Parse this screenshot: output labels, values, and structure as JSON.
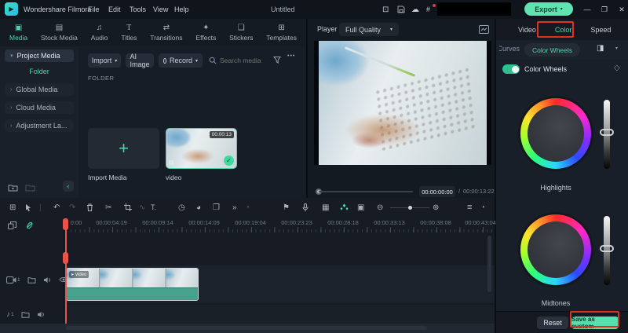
{
  "titlebar": {
    "app_name": "Wondershare Filmora",
    "menus": [
      "File",
      "Edit",
      "Tools",
      "View",
      "Help"
    ],
    "project_name": "Untitled",
    "export_label": "Export",
    "logo_glyph": "▶",
    "icons": {
      "display": "⊡",
      "cloud": "☁",
      "shortcut": "#",
      "chevron": "▾",
      "minimize": "—",
      "restore": "❐",
      "close": "✕"
    }
  },
  "media_panel": {
    "tabs": [
      {
        "label": "Media",
        "icon": "▣"
      },
      {
        "label": "Stock Media",
        "icon": "▤"
      },
      {
        "label": "Audio",
        "icon": "♫"
      },
      {
        "label": "Titles",
        "icon": "T"
      },
      {
        "label": "Transitions",
        "icon": "⇄"
      },
      {
        "label": "Effects",
        "icon": "✦"
      },
      {
        "label": "Stickers",
        "icon": "❏"
      },
      {
        "label": "Templates",
        "icon": "⊞"
      }
    ],
    "sidebar": {
      "project": "Project Media",
      "folder": "Folder",
      "items": [
        "Global Media",
        "Cloud Media",
        "Adjustment La..."
      ],
      "chevron_open": "▾",
      "chevron": "›",
      "collapse": "‹"
    },
    "toolbar": {
      "import_label": "Import",
      "ai_label": "AI Image",
      "record_label": "Record",
      "search_placeholder": "Search media",
      "more": "•••",
      "chevron": "▾"
    },
    "section_label": "FOLDER",
    "tiles": {
      "plus": "+",
      "import_label": "Import Media",
      "video_label": "video",
      "duration": "00:00:13",
      "check": "✓",
      "clip_type": "▤"
    }
  },
  "player": {
    "label": "Player",
    "quality": "Full Quality",
    "chevron": "▾",
    "current_time": "00:00:00:00",
    "separator": "/",
    "total_time": "00:00:13:22",
    "controls": {
      "prev_frame": "◁",
      "next_frame": "❘▷",
      "play": "▷",
      "mark_in": "{",
      "mark_out": "}"
    }
  },
  "color_panel": {
    "tabs": [
      "Video",
      "Color",
      "Speed"
    ],
    "modes": {
      "curves": "Curves",
      "wheels": "Color Wheels",
      "compare": "◨",
      "chevron": "▾"
    },
    "toggle_label": "Color Wheels",
    "reset_diamond": "◇",
    "wheel1_label": "Highlights",
    "wheel2_label": "Midtones",
    "reset_label": "Reset",
    "save_label": "Save as custom"
  },
  "timeline": {
    "tools": {
      "grid": "⊞",
      "undo": "↶",
      "redo": "↷",
      "cut": "✂",
      "wave": "∿",
      "text": "T.",
      "speed": "◷",
      "palette": "◕",
      "pip": "❐",
      "more": "»",
      "preview": "◔",
      "marker": "⚑",
      "split": "▦",
      "bracket": "▣",
      "zoom_out": "⊖",
      "zoom_in": "⊕",
      "tracks": "≡",
      "tracks_dot": "‣"
    },
    "ruler": [
      "0:00",
      "00:00:04:19",
      "00:00:09:14",
      "00:00:14:09",
      "00:00:19:04",
      "00:00:23:23",
      "00:00:28:18",
      "00:00:33:13",
      "00:00:38:08",
      "00:00:43:04"
    ],
    "clip_play": "▸",
    "clip_label": "video",
    "track_video_num": "1",
    "track_audio_num": "1",
    "note": "♪"
  },
  "accent_color": "#4ad6ac",
  "annotation_color": "#dd3222"
}
